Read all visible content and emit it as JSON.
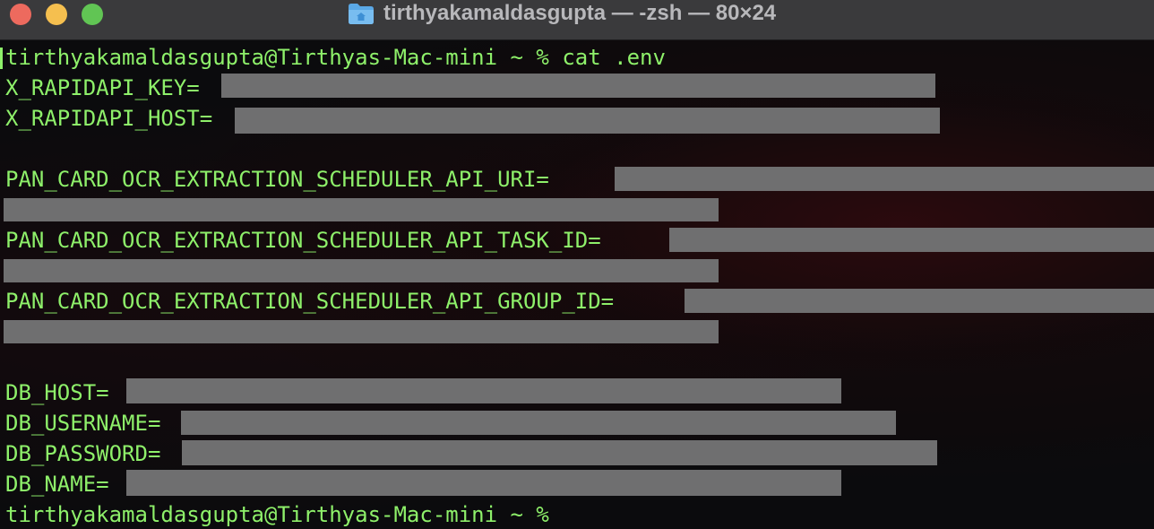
{
  "window": {
    "title": "tirthyakamaldasgupta — -zsh — 80×24",
    "folder_icon": "folder-icon"
  },
  "terminal": {
    "lines": [
      "tirthyakamaldasgupta@Tirthyas-Mac-mini ~ % cat .env",
      "X_RAPIDAPI_KEY=",
      "X_RAPIDAPI_HOST=",
      "",
      "PAN_CARD_OCR_EXTRACTION_SCHEDULER_API_URI=",
      "",
      "PAN_CARD_OCR_EXTRACTION_SCHEDULER_API_TASK_ID=",
      "",
      "PAN_CARD_OCR_EXTRACTION_SCHEDULER_API_GROUP_ID=",
      "",
      "",
      "DB_HOST=",
      "DB_USERNAME=",
      "DB_PASSWORD=",
      "DB_NAME=",
      "tirthyakamaldasgupta@Tirthyas-Mac-mini ~ %"
    ]
  },
  "colors": {
    "text": "#8ef06a",
    "redaction": "#6f6f70",
    "background": "#0b0b0d",
    "titlebar": "#3a3a3c"
  }
}
